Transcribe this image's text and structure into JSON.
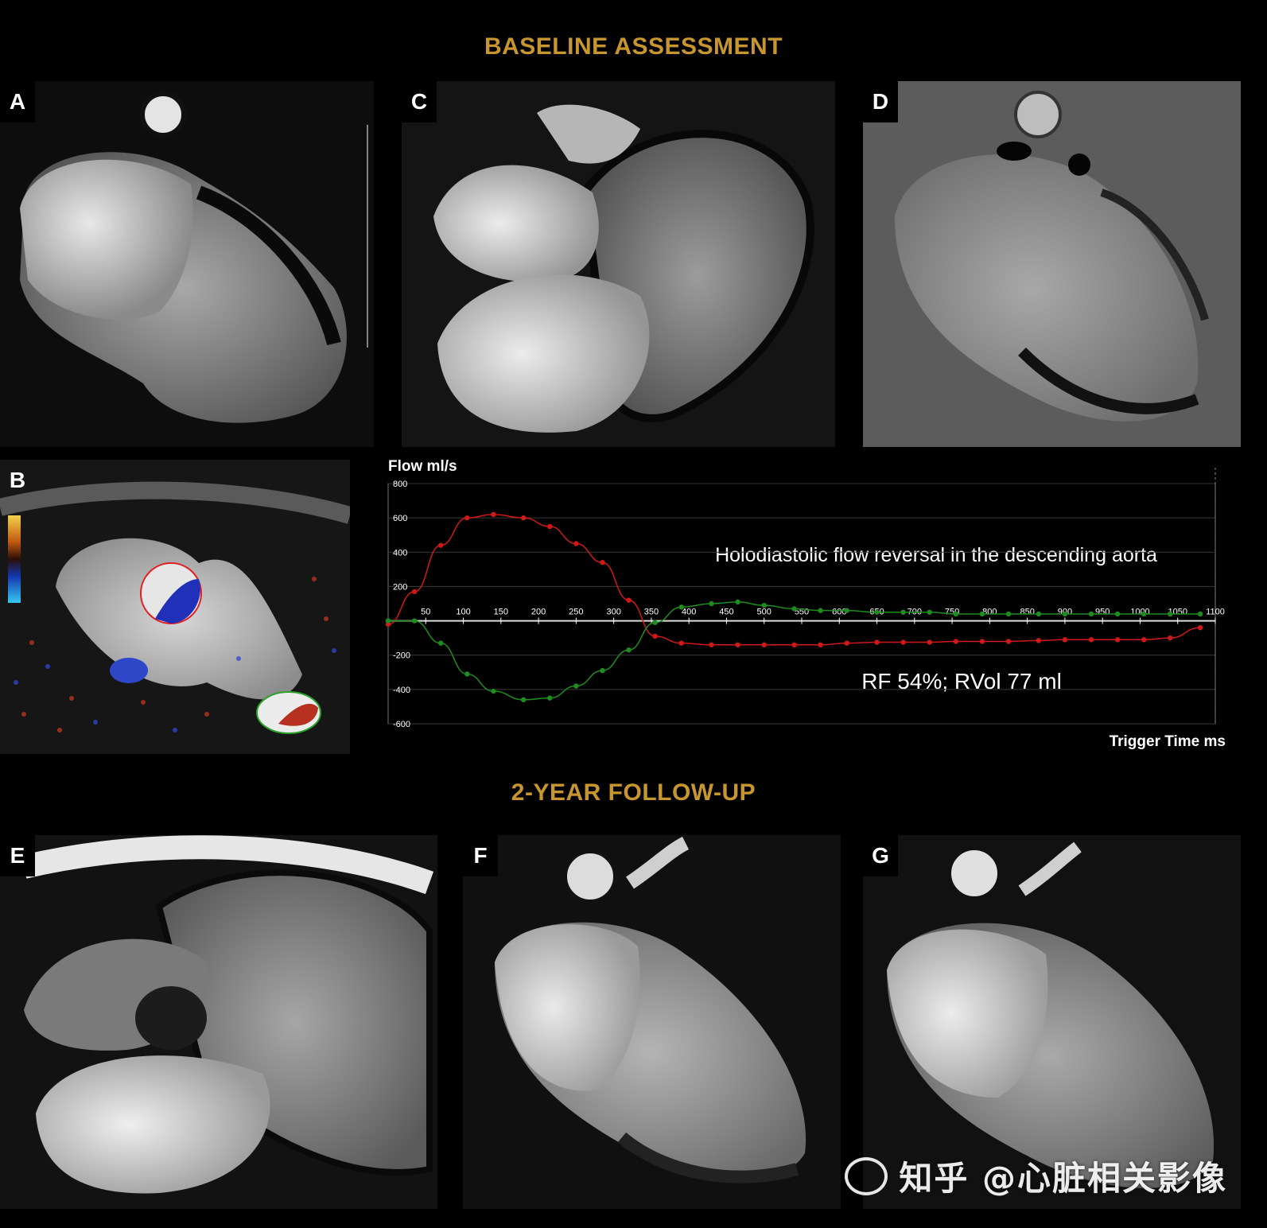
{
  "titles": {
    "baseline": "BASELINE ASSESSMENT",
    "followup": "2-YEAR FOLLOW-UP"
  },
  "panels": [
    {
      "id": "A",
      "label": "A"
    },
    {
      "id": "B",
      "label": "B"
    },
    {
      "id": "C",
      "label": "C"
    },
    {
      "id": "D",
      "label": "D"
    },
    {
      "id": "E",
      "label": "E"
    },
    {
      "id": "F",
      "label": "F"
    },
    {
      "id": "G",
      "label": "G"
    }
  ],
  "colors": {
    "title": "#c8962e",
    "forward_flow": "#d01818",
    "reverse_flow": "#1e8c1e"
  },
  "chart_data": {
    "type": "line",
    "ylabel": "Flow ml/s",
    "xlabel": "Trigger Time ms",
    "annotation_top": "Holodiastolic flow reversal in the descending aorta",
    "annotation_bottom": "RF 54%; RVol 77 ml",
    "xlim": [
      0,
      1100
    ],
    "ylim": [
      -600,
      800
    ],
    "x_ticks": [
      50,
      100,
      150,
      200,
      250,
      300,
      350,
      400,
      450,
      500,
      550,
      600,
      650,
      700,
      750,
      800,
      850,
      900,
      950,
      1000,
      1050,
      1100
    ],
    "y_ticks": [
      800,
      600,
      400,
      200,
      0,
      -200,
      -400,
      -600
    ],
    "series": [
      {
        "color": "#d01818",
        "x": [
          0,
          35,
          70,
          105,
          140,
          180,
          215,
          250,
          285,
          320,
          355,
          390,
          430,
          465,
          500,
          540,
          575,
          610,
          650,
          685,
          720,
          755,
          790,
          825,
          865,
          900,
          935,
          970,
          1005,
          1040,
          1080
        ],
        "values": [
          -20,
          170,
          440,
          600,
          620,
          600,
          550,
          450,
          340,
          120,
          -90,
          -130,
          -140,
          -140,
          -140,
          -140,
          -140,
          -130,
          -125,
          -125,
          -125,
          -120,
          -120,
          -120,
          -115,
          -110,
          -110,
          -110,
          -110,
          -100,
          -40
        ]
      },
      {
        "color": "#1e8c1e",
        "x": [
          0,
          35,
          70,
          105,
          140,
          180,
          215,
          250,
          285,
          320,
          355,
          390,
          430,
          465,
          500,
          540,
          575,
          610,
          650,
          685,
          720,
          755,
          790,
          825,
          865,
          900,
          935,
          970,
          1005,
          1040,
          1080
        ],
        "values": [
          0,
          0,
          -130,
          -310,
          -410,
          -460,
          -450,
          -380,
          -290,
          -170,
          -10,
          80,
          100,
          110,
          90,
          70,
          60,
          60,
          50,
          50,
          50,
          40,
          40,
          40,
          40,
          40,
          40,
          40,
          40,
          40,
          40
        ]
      }
    ]
  },
  "watermark": "知乎 @心脏相关影像"
}
